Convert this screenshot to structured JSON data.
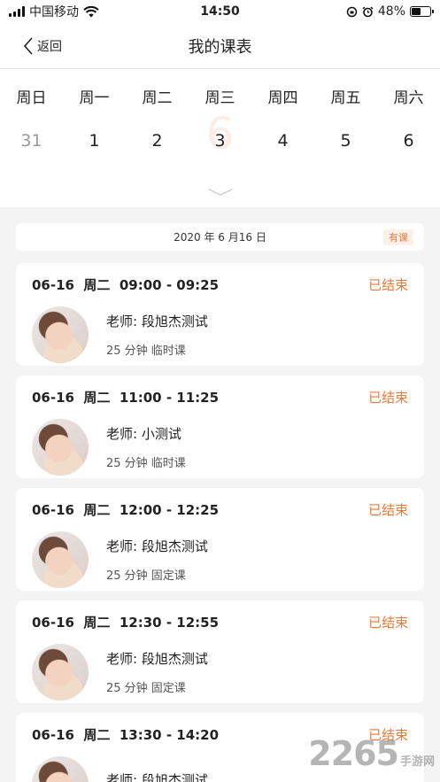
{
  "status_bar": {
    "carrier": "中国移动",
    "time": "14:50",
    "battery": "48%",
    "battery_level": 0.48
  },
  "nav": {
    "back_label": "返回",
    "title": "我的课表"
  },
  "calendar": {
    "weekdays": [
      "周日",
      "周一",
      "周二",
      "周三",
      "周四",
      "周五",
      "周六"
    ],
    "dates": [
      "31",
      "1",
      "2",
      "3",
      "4",
      "5",
      "6"
    ],
    "highlight_ghost": "6"
  },
  "day_banner": {
    "date": "2020 年 6 月16 日",
    "badge": "有课"
  },
  "lessons": [
    {
      "time": "06-16  周二  09:00 - 09:25",
      "status": "已结束",
      "teacher": "老师: 段旭杰测试",
      "meta": "25 分钟  临时课"
    },
    {
      "time": "06-16  周二  11:00 - 11:25",
      "status": "已结束",
      "teacher": "老师: 小测试",
      "meta": "25 分钟  临时课"
    },
    {
      "time": "06-16  周二  12:00 - 12:25",
      "status": "已结束",
      "teacher": "老师: 段旭杰测试",
      "meta": "25 分钟  固定课"
    },
    {
      "time": "06-16  周二  12:30 - 12:55",
      "status": "已结束",
      "teacher": "老师: 段旭杰测试",
      "meta": "25 分钟  固定课"
    },
    {
      "time": "06-16  周二  13:30 - 14:20",
      "status": "已结束",
      "teacher": "老师: 段旭杰测试",
      "meta": ""
    }
  ],
  "watermark": {
    "number": "2265",
    "text": "手游网"
  },
  "colors": {
    "accent": "#e87c3e",
    "background": "#f4f4f4"
  }
}
